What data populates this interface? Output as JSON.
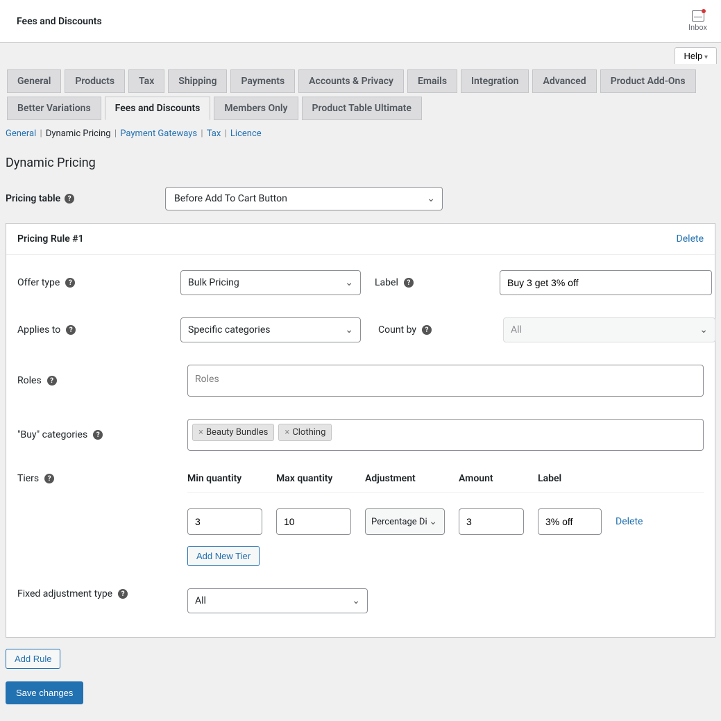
{
  "header": {
    "title": "Fees and Discounts",
    "inbox_label": "Inbox",
    "help_label": "Help"
  },
  "tabs": {
    "row1": [
      "General",
      "Products",
      "Tax",
      "Shipping",
      "Payments",
      "Accounts & Privacy",
      "Emails",
      "Integration",
      "Advanced",
      "Product Add-Ons"
    ],
    "row2": [
      "Better Variations",
      "Fees and Discounts",
      "Members Only",
      "Product Table Ultimate"
    ],
    "active": "Fees and Discounts"
  },
  "subtabs": {
    "items": [
      "General",
      "Dynamic Pricing",
      "Payment Gateways",
      "Tax",
      "Licence"
    ],
    "current": "Dynamic Pricing"
  },
  "section_title": "Dynamic Pricing",
  "pricing_table": {
    "label": "Pricing table",
    "value": "Before Add To Cart Button"
  },
  "rule": {
    "title": "Pricing Rule #1",
    "delete_label": "Delete",
    "offer_type_label": "Offer type",
    "offer_type_value": "Bulk Pricing",
    "label_label": "Label",
    "label_value": "Buy 3 get 3% off",
    "applies_to_label": "Applies to",
    "applies_to_value": "Specific categories",
    "count_by_label": "Count by",
    "count_by_value": "All",
    "roles_label": "Roles",
    "roles_placeholder": "Roles",
    "buy_categories_label": "\"Buy\" categories",
    "buy_categories": [
      "Beauty Bundles",
      "Clothing"
    ],
    "tiers_label": "Tiers",
    "tiers": {
      "headers": {
        "min": "Min quantity",
        "max": "Max quantity",
        "adj": "Adjustment",
        "amt": "Amount",
        "lbl": "Label"
      },
      "rows": [
        {
          "min": "3",
          "max": "10",
          "adj": "Percentage Di",
          "amt": "3",
          "lbl": "3% off"
        }
      ],
      "delete_label": "Delete",
      "add_tier_label": "Add New Tier"
    },
    "fixed_adj_label": "Fixed adjustment type",
    "fixed_adj_value": "All"
  },
  "buttons": {
    "add_rule": "Add Rule",
    "save": "Save changes"
  }
}
